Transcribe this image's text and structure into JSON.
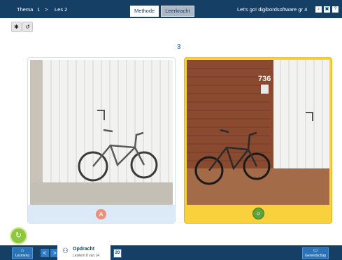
{
  "topbar": {
    "thema": "Thema",
    "thema_num": "1",
    "separator": ">",
    "les": "Les 2",
    "tabs": [
      "Methode",
      "Leerkracht"
    ],
    "app_title": "Let's go! digibordsoftware gr 4"
  },
  "main": {
    "page_number": "3",
    "left_card_badge": "A",
    "right_card_badge": "☺"
  },
  "bottombar": {
    "lesmenu_label": "Lesmenu",
    "opdracht_title": "Opdracht",
    "opdracht_sub": "Lesitem 8 van 14",
    "page_box": "20",
    "right_button_label": "Gereedschap"
  },
  "colors": {
    "header": "#163f66",
    "accent_yellow": "#f8d13c",
    "accent_blue": "#2a73b8"
  }
}
